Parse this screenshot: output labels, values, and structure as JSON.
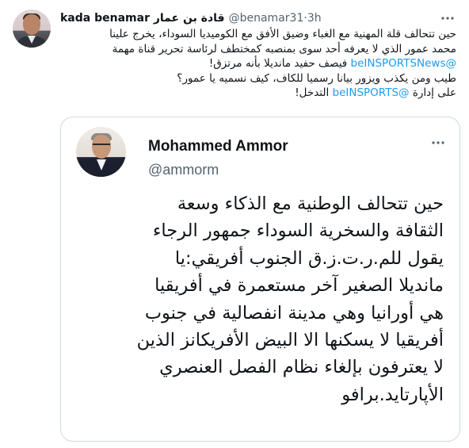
{
  "tweet": {
    "display_name": "kada benamar قادة بن عمار",
    "handle": "@benamar31",
    "separator": "·",
    "time": "3h",
    "body": {
      "line1": "حين تتحالف قلة المهنية مع الغباء وضيق الأفق مع الكوميديا السوداء، يخرج علينا",
      "line2": "محمد عمور الذي لا يعرفه أحد سوى بمنصبه كمختطف لرئاسة تحرير قناة مهمة",
      "line3_mention": "@beINSPORTSNews",
      "line3_text": " فيصف حفيد مانديلا بأنه مرتزق!",
      "line4": "طيب ومن يكذب ويزور بيانا رسميا للكاف، كيف نسميه يا عمور؟",
      "line5_pre": "على إدارة ",
      "line5_mention": "@beINSPORTS",
      "line5_post": " التدخل!"
    }
  },
  "quote": {
    "name": "Mohammed Ammor",
    "handle": "@ammorm",
    "lines": [
      "حين تتحالف الوطنية مع الذكاء وسعة",
      "الثقافة والسخرية السوداء جمهور الرجاء",
      "يقول للم.ر.ت.ز.ق الجنوب أفريقي:يا",
      "مانديلا الصغير آخر مستعمرة في أفريقيا",
      "هي أورانيا وهي مدينة انفصالية في جنوب",
      "أفريقيا لا يسكنها الا البيض الأفريكانز الذين",
      "لا يعترفون بإلغاء نظام الفصل العنصري",
      "الأپارتايد.برافو"
    ]
  },
  "icons": {
    "more": "more-horizontal-icon"
  },
  "colors": {
    "link": "#1d9bf0",
    "secondary_text": "#536471",
    "border": "#cfd9de"
  }
}
